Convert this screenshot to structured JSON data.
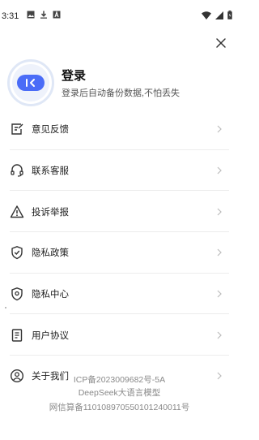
{
  "status_bar": {
    "time": "3:31"
  },
  "profile": {
    "title": "登录",
    "subtitle": "登录后自动备份数据,不怕丢失"
  },
  "menu": {
    "items": [
      {
        "label": "意见反馈",
        "icon": "feedback-icon"
      },
      {
        "label": "联系客服",
        "icon": "headset-icon"
      },
      {
        "label": "投诉举报",
        "icon": "warning-icon"
      },
      {
        "label": "隐私政策",
        "icon": "shield-check-icon"
      },
      {
        "label": "隐私中心",
        "icon": "location-shield-icon"
      },
      {
        "label": "用户协议",
        "icon": "document-icon"
      },
      {
        "label": "关于我们",
        "icon": "user-circle-icon"
      }
    ]
  },
  "footer": {
    "icp": "ICP备2023009682号-5A",
    "model": "DeepSeek大语言模型",
    "filing": "网信算备110108970550101240011号"
  },
  "colors": {
    "accent": "#4a6cf7",
    "text": "#1f1f1f",
    "muted": "#8a8a8a",
    "divider": "#ececec"
  }
}
